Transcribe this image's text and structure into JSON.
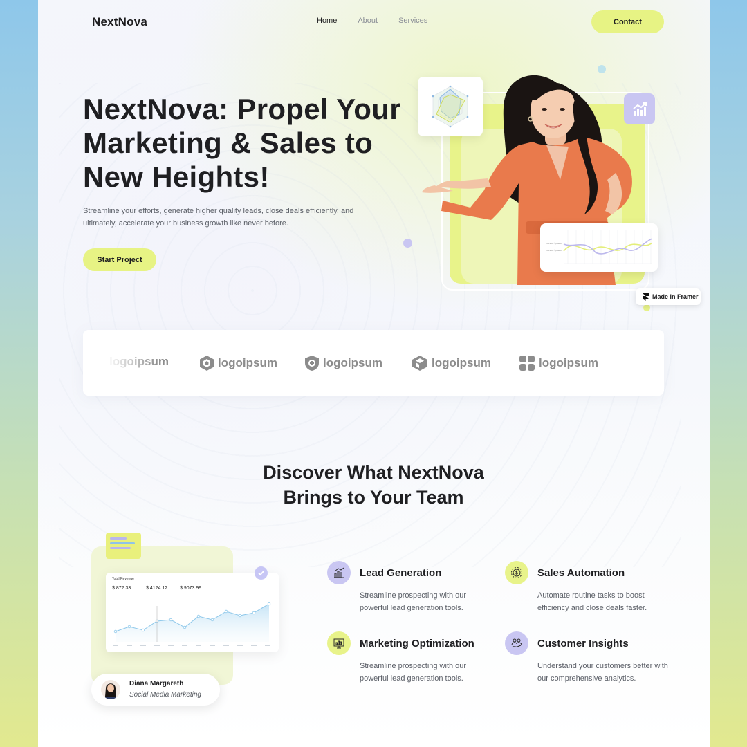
{
  "nav": {
    "logo": "NextNova",
    "links": [
      "Home",
      "About",
      "Services"
    ],
    "contact_label": "Contact"
  },
  "hero": {
    "title": "NextNova: Propel Your Marketing & Sales to New Heights!",
    "subtitle": "Streamline your efforts, generate higher quality leads, close deals efficiently, and ultimately, accelerate your business growth like never before.",
    "cta_label": "Start Project",
    "legend_labels": [
      "Lorem Ipsum",
      "Lorem Ipsum"
    ]
  },
  "badge": {
    "label": "Made in Framer"
  },
  "logos": [
    "logoipsum",
    "logoipsum",
    "logoipsum",
    "logoipsum",
    "logoipsum"
  ],
  "discover": {
    "title_line1": "Discover What NextNova",
    "title_line2": "Brings to Your Team"
  },
  "dashboard": {
    "card_title": "Total Revenue",
    "values": [
      "$ 872.33",
      "$ 4124.12",
      "$ 9073.99"
    ],
    "profile_name": "Diana Margareth",
    "profile_role": "Social Media Marketing"
  },
  "features": [
    {
      "title": "Lead Generation",
      "desc": "Streamline prospecting with our powerful lead generation tools.",
      "icon": "growth-chart-icon",
      "color": "#c9c6f2"
    },
    {
      "title": "Sales Automation",
      "desc": "Automate routine tasks to  boost efficiency and close  deals faster.",
      "icon": "gear-dollar-icon",
      "color": "#e8f38a"
    },
    {
      "title": "Marketing Optimization",
      "desc": "Streamline prospecting with our powerful lead generation tools.",
      "icon": "analytics-board-icon",
      "color": "#e8f38a"
    },
    {
      "title": "Customer Insights",
      "desc": "Understand your customers better with our comprehensive analytics.",
      "icon": "people-icon",
      "color": "#c9c6f2"
    }
  ],
  "colors": {
    "accent_yellow": "#e7f384",
    "accent_lavender": "#c9c6f2",
    "text_dark": "#1f1f22"
  }
}
